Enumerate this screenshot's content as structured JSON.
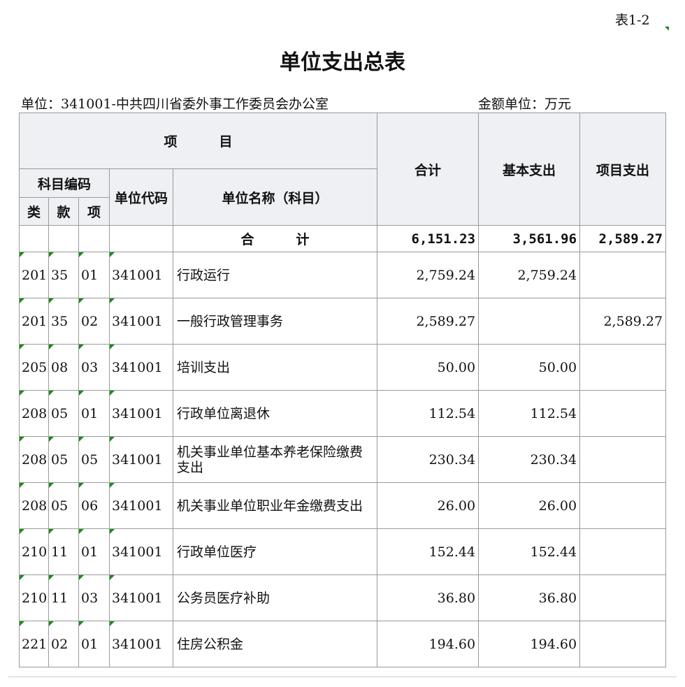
{
  "table_no": "表1-2",
  "title": "单位支出总表",
  "unit_label": "单位：341001-中共四川省委外事工作委员会办公室",
  "amount_unit": "金额单位：万元",
  "headers": {
    "item": [
      "项",
      "目"
    ],
    "subject_code": "科目编码",
    "lei": "类",
    "kuan": "款",
    "xiang": "项",
    "unit_code": "单位代码",
    "unit_name": "单位名称（科目）",
    "total": "合计",
    "basic": "基本支出",
    "project": "项目支出"
  },
  "total_row": {
    "label": [
      "合",
      "计"
    ],
    "total": "6,151.23",
    "basic": "3,561.96",
    "project": "2,589.27"
  },
  "rows": [
    {
      "lei": "201",
      "kuan": "35",
      "xiang": "01",
      "unit_code": "341001",
      "name": "行政运行",
      "total": "2,759.24",
      "basic": "2,759.24",
      "project": ""
    },
    {
      "lei": "201",
      "kuan": "35",
      "xiang": "02",
      "unit_code": "341001",
      "name": "一般行政管理事务",
      "total": "2,589.27",
      "basic": "",
      "project": "2,589.27"
    },
    {
      "lei": "205",
      "kuan": "08",
      "xiang": "03",
      "unit_code": "341001",
      "name": "培训支出",
      "total": "50.00",
      "basic": "50.00",
      "project": ""
    },
    {
      "lei": "208",
      "kuan": "05",
      "xiang": "01",
      "unit_code": "341001",
      "name": "行政单位离退休",
      "total": "112.54",
      "basic": "112.54",
      "project": ""
    },
    {
      "lei": "208",
      "kuan": "05",
      "xiang": "05",
      "unit_code": "341001",
      "name": "机关事业单位基本养老保险缴费支出",
      "total": "230.34",
      "basic": "230.34",
      "project": ""
    },
    {
      "lei": "208",
      "kuan": "05",
      "xiang": "06",
      "unit_code": "341001",
      "name": "机关事业单位职业年金缴费支出",
      "total": "26.00",
      "basic": "26.00",
      "project": ""
    },
    {
      "lei": "210",
      "kuan": "11",
      "xiang": "01",
      "unit_code": "341001",
      "name": "行政单位医疗",
      "total": "152.44",
      "basic": "152.44",
      "project": ""
    },
    {
      "lei": "210",
      "kuan": "11",
      "xiang": "03",
      "unit_code": "341001",
      "name": "公务员医疗补助",
      "total": "36.80",
      "basic": "36.80",
      "project": ""
    },
    {
      "lei": "221",
      "kuan": "02",
      "xiang": "01",
      "unit_code": "341001",
      "name": "住房公积金",
      "total": "194.60",
      "basic": "194.60",
      "project": ""
    }
  ]
}
